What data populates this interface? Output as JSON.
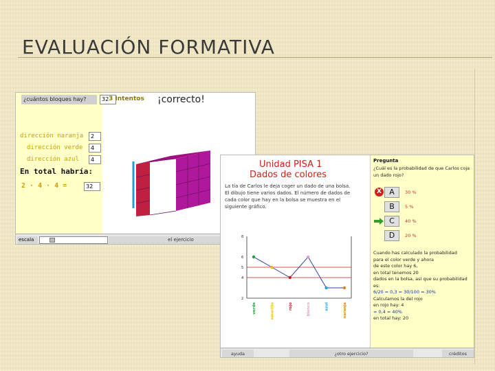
{
  "slide": {
    "title": "EVALUACIÓN FORMATIVA"
  },
  "left_app": {
    "question_label": "¿cuántos bloques hay?",
    "question_value": "32",
    "attempts": "3  Intentos",
    "result": "¡correcto!",
    "directions": [
      {
        "label": "dirección naranja",
        "value": "2"
      },
      {
        "label": "dirección verde",
        "value": "4"
      },
      {
        "label": "dirección azul",
        "value": "4"
      }
    ],
    "total_label": "En total habría:",
    "expression": "2 · 4 · 4 =",
    "expression_result": "32",
    "scale_label": "escala",
    "exercise_label": "el ejercicio",
    "colors": {
      "panel": "#ffffc8",
      "direction_text": "#c8a000",
      "cube_top": "#a01080",
      "cube_front": "#b0189c",
      "cube_side": "#c02040"
    }
  },
  "right_app": {
    "unit_title": "Unidad PISA 1",
    "unit_subtitle": "Dados de colores",
    "intro_text": "La tía de Carlos le deja coger un dado de una bolsa. El dibujo tiene varios dados. El número de dados de cada color que hay en la bolsa se muestra en el siguiente gráfico.",
    "question_heading": "Pregunta",
    "question_text": "¿Cuál es la probabilidad de que Carlos coja un dado rojo?",
    "options": [
      {
        "letter": "A",
        "value": "30 %"
      },
      {
        "letter": "B",
        "value": "5 %"
      },
      {
        "letter": "C",
        "value": "40 %"
      },
      {
        "letter": "D",
        "value": "20 %"
      }
    ],
    "wrong_marker": "X",
    "explanation_lines": [
      "Cuando has calculado la probabilidad",
      "para el color verde y ahora",
      "de este color hay 6,",
      "en total tenemos 20",
      "dados en la bolsa, así que su probabilidad es:",
      "6/20 = 0,3 = 30/100 = 30%",
      "Calculamos la del rojo",
      "en rojo hay: 4",
      "en total hay: 20"
    ],
    "formula_result": "= 0,4 = 40%",
    "bottom_buttons": [
      "ayuda",
      "¿otro ejercicio?",
      "créditos"
    ],
    "chart_data": {
      "type": "line",
      "categories": [
        "verde",
        "amarillo",
        "rojo",
        "blanco",
        "azul",
        "naranja"
      ],
      "values": [
        6,
        5,
        4,
        6,
        3,
        3
      ],
      "ylim": [
        2,
        8
      ],
      "y_ticks": [
        8,
        6,
        5,
        4,
        2
      ],
      "reference_lines": [
        5,
        4
      ],
      "point_colors": [
        "#20a040",
        "#e0c000",
        "#c02020",
        "#e0a0c0",
        "#20a0e0",
        "#e08020"
      ],
      "line_color": "#3040a0"
    }
  }
}
